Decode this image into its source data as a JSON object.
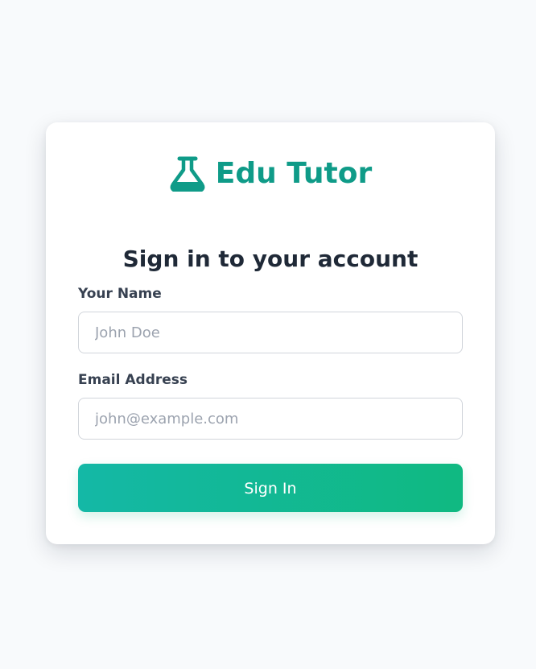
{
  "brand": {
    "name": "Edu Tutor",
    "icon": "flask-icon",
    "color": "#0f9b88"
  },
  "form": {
    "title": "Sign in to your account",
    "fields": {
      "name": {
        "label": "Your Name",
        "value": "",
        "placeholder": "John Doe"
      },
      "email": {
        "label": "Email Address",
        "value": "",
        "placeholder": "john@example.com"
      }
    },
    "submit_label": "Sign In",
    "submit_gradient": [
      "#14b8a6",
      "#10b981"
    ]
  }
}
